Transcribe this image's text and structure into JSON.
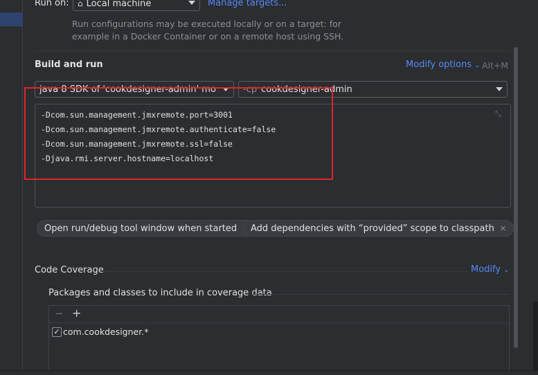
{
  "run_on": {
    "label": "Run on:",
    "selected": "Local machine",
    "manage_link": "Manage targets...",
    "hint_line1": "Run configurations may be executed locally or on a target: for",
    "hint_line2": "example in a Docker Container or on a remote host using SSH."
  },
  "build_and_run": {
    "title": "Build and run",
    "modify_options": "Modify options",
    "shortcut": "Alt+M",
    "jdk_combo": "java 8 SDK of 'cookdesigner-admin' mo",
    "classpath_prefix": "-cp",
    "classpath_module": "cookdesigner-admin",
    "vm_options": [
      "-Dcom.sun.management.jmxremote.port=3001",
      "-Dcom.sun.management.jmxremote.authenticate=false",
      "-Dcom.sun.management.jmxremote.ssl=false",
      "-Djava.rmi.server.hostname=localhost"
    ]
  },
  "chips": [
    "Open run/debug tool window when started",
    "Add dependencies with “provided” scope to classpath"
  ],
  "code_coverage": {
    "title": "Code Coverage",
    "modify": "Modify",
    "packages_label": "Packages and classes to include in coverage data",
    "entries": [
      {
        "pattern": "com.cookdesigner.*",
        "checked": true
      }
    ]
  },
  "colors": {
    "accent_link": "#548af7",
    "highlight_border": "#e0252a",
    "background": "#2b2d30"
  }
}
